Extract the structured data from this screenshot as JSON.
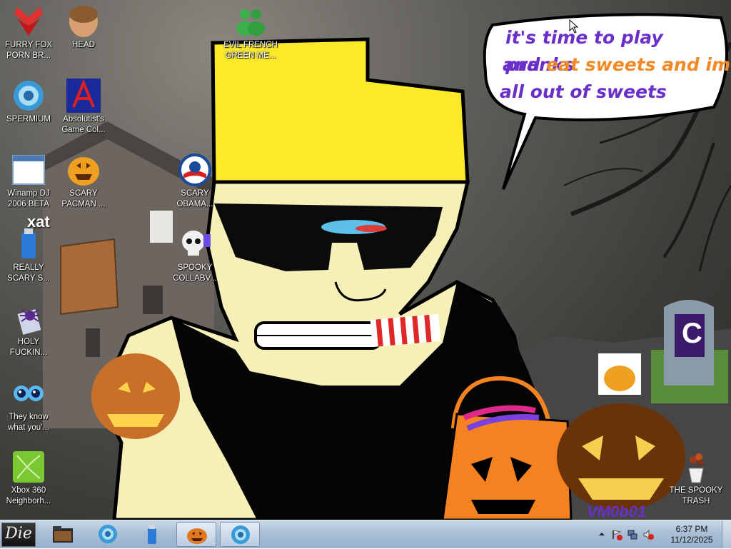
{
  "desktop": {
    "icons": [
      {
        "label": "FURRY FOX PORN BR...",
        "icon": "red-fox-icon"
      },
      {
        "label": "HEAD",
        "icon": "head-icon"
      },
      {
        "label": "EVIL FRENCH GREEN ME...",
        "icon": "messenger-icon"
      },
      {
        "label": "SPERMIUM",
        "icon": "browser-icon"
      },
      {
        "label": "Absolutist's Game Col...",
        "icon": "game-collection-icon"
      },
      {
        "label": "Winamp DJ 2006 BETA",
        "icon": "winamp-icon"
      },
      {
        "label": "SCARY PACMAN ...",
        "icon": "pacman-pumpkin-icon"
      },
      {
        "label": "SCARY OBAMA...",
        "icon": "obama-logo-icon"
      },
      {
        "label": "REALLY SCARY S...",
        "icon": "usb-drive-icon"
      },
      {
        "label": "SPOOKY COLLABV...",
        "icon": "skull-icon"
      },
      {
        "label": "HOLY FUCKIN...",
        "icon": "spider-icon"
      },
      {
        "label": "They know what you'...",
        "icon": "eyes-icon"
      },
      {
        "label": "Xbox 360 Neighborh...",
        "icon": "xbox-icon"
      },
      {
        "label": "THE SPOOKY TRASH",
        "icon": "trash-icon"
      }
    ],
    "speech_bubble": {
      "line1": "it's time to play pranks",
      "line2_a": "and ",
      "line2_b": "eat sweets and im",
      "line3": "all out of sweets"
    },
    "xat_logo": "xat",
    "watermark": "VM0b01",
    "tombstone_letter": "C"
  },
  "taskbar": {
    "start_label": "Die",
    "clock_time": "6:37 PM",
    "clock_date": "11/12/2025",
    "buttons": [
      "folder-icon",
      "browser-icon",
      "usb-drive-icon",
      "pumpkin-icon",
      "browser-icon"
    ]
  }
}
